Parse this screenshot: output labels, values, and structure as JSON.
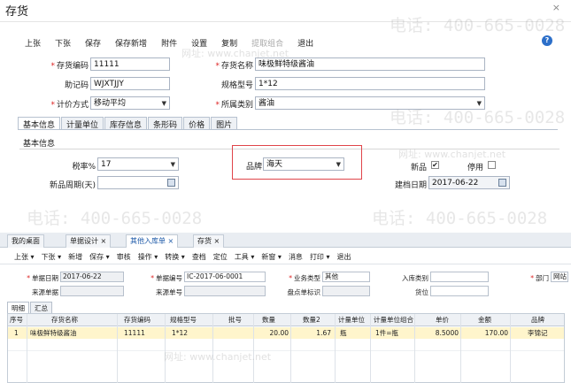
{
  "window": {
    "title": "存货",
    "close": "×"
  },
  "toolbar": [
    "上张",
    "下张",
    "保存",
    "保存新增",
    "附件",
    "设置",
    "复制",
    "提取组合",
    "退出"
  ],
  "form": {
    "code_label": "存货编码",
    "code_value": "11111",
    "name_label": "存货名称",
    "name_value": "味极鲜特级酱油",
    "mnemonic_label": "助记码",
    "mnemonic_value": "WJXTJJY",
    "spec_label": "规格型号",
    "spec_value": "1*12",
    "pricing_label": "计价方式",
    "pricing_value": "移动平均",
    "category_label": "所属类别",
    "category_value": "酱油"
  },
  "tabs": [
    "基本信息",
    "计量单位",
    "库存信息",
    "条形码",
    "价格",
    "图片"
  ],
  "basic": {
    "section_title": "基本信息",
    "tax_label": "税率%",
    "tax_value": "17",
    "brand_label": "品牌",
    "brand_value": "海天",
    "new_label": "新品",
    "new_checked": "✔",
    "disabled_label": "停用",
    "new_cycle_label": "新品周期(天)",
    "created_label": "建档日期",
    "created_value": "2017-06-22"
  },
  "app": {
    "tabs": [
      "我的桌面",
      "单据设计",
      "其他入库单",
      "存货"
    ],
    "toolbar": [
      "上张 ▾",
      "下张 ▾",
      "新增",
      "保存 ▾",
      "审核",
      "操作 ▾",
      "转换 ▾",
      "查档",
      "定位",
      "工具 ▾",
      "新窗 ▾",
      "消息",
      "打印 ▾",
      "退出"
    ],
    "doc_date_label": "单据日期",
    "doc_date_value": "2017-06-22",
    "doc_no_label": "单据编号",
    "doc_no_value": "IC-2017-06-0001",
    "biz_type_label": "业务类型",
    "biz_type_value": "其他",
    "in_type_label": "入库类别",
    "dept_label": "部门",
    "dept_value": "网站",
    "src_label": "来源单据",
    "src_no_label": "来源单号",
    "detail_label": "盘点单标识",
    "pos_label": "货位",
    "subtabs": [
      "明细",
      "汇总"
    ],
    "columns": [
      "序号",
      "存货名称",
      "存货编码",
      "规格型号",
      "批号",
      "数量",
      "数量2",
      "计量单位",
      "计量单位组合",
      "单价",
      "金额",
      "品牌"
    ],
    "row": [
      "1",
      "味极鲜特级酱油",
      "11111",
      "1*12",
      "",
      "20.00",
      "1.67",
      "瓶",
      "1件=瓶",
      "8.5000",
      "170.00",
      "李锦记"
    ]
  },
  "watermark": {
    "phone": "电话: 400-665-0028",
    "site": "网址: www.chanjet.net"
  }
}
